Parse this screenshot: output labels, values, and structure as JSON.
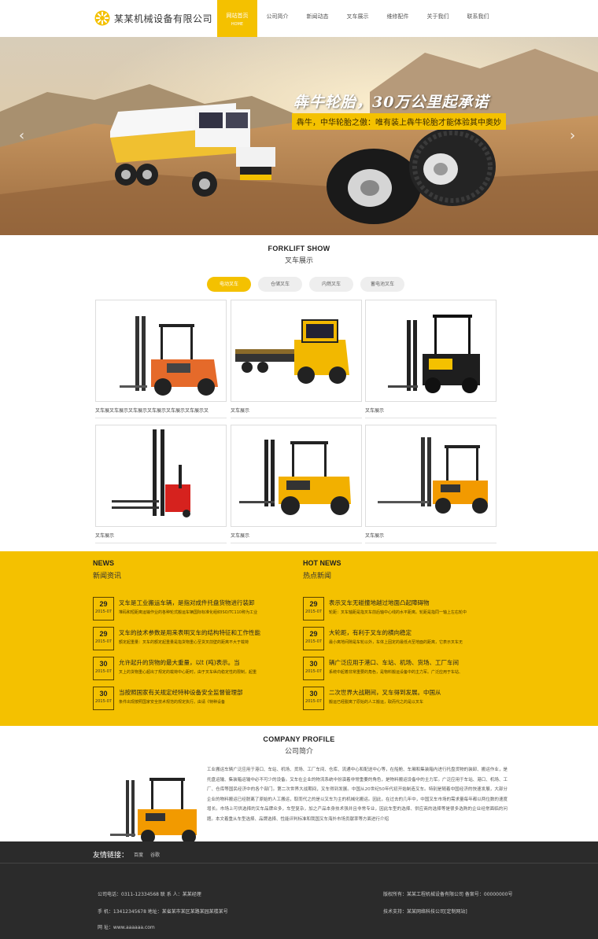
{
  "header": {
    "company_name": "某某机械设备有限公司",
    "nav": [
      {
        "label": "网站首页",
        "sub": "HOME",
        "active": true
      },
      {
        "label": "公司简介"
      },
      {
        "label": "新闻动态"
      },
      {
        "label": "叉车展示"
      },
      {
        "label": "维修配件"
      },
      {
        "label": "关于我们"
      },
      {
        "label": "联系我们"
      }
    ]
  },
  "banner": {
    "headline": "犇牛轮胎，30万公里起承诺",
    "subline": "犇牛，中华轮胎之傲：唯有装上犇牛轮胎才能体验其中奥妙",
    "prev": "‹",
    "next": "›"
  },
  "forklift": {
    "title_en": "FORKLIFT SHOW",
    "title_cn": "叉车展示",
    "tabs": [
      "电动叉车",
      "仓储叉车",
      "内燃叉车",
      "蓄电池叉车"
    ],
    "products": [
      {
        "caption": "叉车展叉车展示叉车展示叉车展示叉车展示叉车展示叉"
      },
      {
        "caption": "叉车展示"
      },
      {
        "caption": "叉车展示"
      },
      {
        "caption": "叉车展示"
      },
      {
        "caption": "叉车展示"
      },
      {
        "caption": "叉车展示"
      }
    ]
  },
  "news": {
    "left": {
      "title_en": "NEWS",
      "title_cn": "新闻资讯",
      "items": [
        {
          "day": "29",
          "ym": "2015-07",
          "title": "叉车是工业搬运车辆，是指对成件托盘货物进行装卸",
          "summary": "堆码和短距离运输作业的各种轮式搬运车辆国际标准化组织ISO/TC110称为工业"
        },
        {
          "day": "29",
          "ym": "2015-07",
          "title": "叉车的技术参数是用来表明叉车的结构特征和工作性能",
          "summary": "额定起重量：叉车的额定起重量是指货物重心至货叉前壁的距离不大于载荷"
        },
        {
          "day": "30",
          "ym": "2015-07",
          "title": "允许起升的货物的最大重量，以t (吨)表示。当",
          "summary": "叉上的货物重心超出了规定的载荷中心距时，由于叉车纵向稳定性的限制，起重"
        },
        {
          "day": "30",
          "ym": "2015-07",
          "title": "当按照国家有关规定经特种设备安全监督管理部",
          "summary": "条件出现按照国家安全技术规范的规定执行。由请《特种设备"
        }
      ]
    },
    "right": {
      "title_en": "HOT NEWS",
      "title_cn": "热点新闻",
      "items": [
        {
          "day": "29",
          "ym": "2015-07",
          "title": "表示叉车无碰撞地越过地面凸起障碍物",
          "summary": "轮距：叉车轴距是指叉车前后轴中心线的水平距离。轮距是指同一轴上左右轮中"
        },
        {
          "day": "29",
          "ym": "2015-07",
          "title": "大轮距，有利于叉车的横向稳定",
          "summary": "最小离地间隙是车轮以外，车体上固定的最低点至地面的距离，它表示叉车无"
        },
        {
          "day": "30",
          "ym": "2015-07",
          "title": "辆广泛应用于港口、车站、机场、货场、工厂车间",
          "summary": "系统中起着非常重要的角色，是物料搬运设备中的主力军。广泛应用于车站、"
        },
        {
          "day": "30",
          "ym": "2015-07",
          "title": "二次世界大战期间，叉车得到发展。中国从",
          "summary": "搬运已经脱离了原始的人工搬运，取而代之的是以叉车"
        }
      ]
    }
  },
  "profile": {
    "title_en": "COMPANY PROFILE",
    "title_cn": "公司简介",
    "text": "工业搬运车辆广泛应用于港口、车站、机场、货场、工厂车间、仓库、流通中心和配送中心等，在船舱、车厢和集装箱内进行托盘货物的装卸、搬运作业，是托盘运输、集装箱运输中必不可少的设备。叉车在企业的物流系统中扮演着非常重要的角色，是物料搬运设备中的主力军。广泛应用于车站、港口、机场、工厂、仓库等国民经济中的各个部门。第二次世界大战期间，叉车得到发展。中国从20世纪50年代初开始制造叉车。特别是随着中国经济的快速发展，大部分企业的物料搬运已经脱离了原始的人工搬运，取而代之的是以叉车为主的机械化搬运。因此，在过去的几年中，中国叉车市场的需求量每年都以两位数的速度增长。市场上可供选择的叉车品牌众多，车型复杂，加之产品本身技术强并且非常专业，因此车型的选择、供应商的选择等是很多选购的企业经常面临的问题。本文着重从车型选择、品牌选择、性能评判标准和我国叉车海外市场贡献率等方面进行介绍"
  },
  "footer": {
    "links_label": "友情链接：",
    "links": [
      "百度",
      "谷歌"
    ],
    "left": [
      "公司电话：0311-12334568 联 系 人：某某经理",
      "手 机：13412345678 地址：某省某市某区某路某园某楼某号",
      "网 址：www.aaaaaa.com"
    ],
    "right": [
      "版权所有：某某工程机械设备有限公司 备案号：00000000号",
      "技术支持：某某网络科技公司[定制网站]"
    ]
  },
  "colors": {
    "accent": "#f4c100",
    "footer_bg": "#2b2b2b"
  }
}
